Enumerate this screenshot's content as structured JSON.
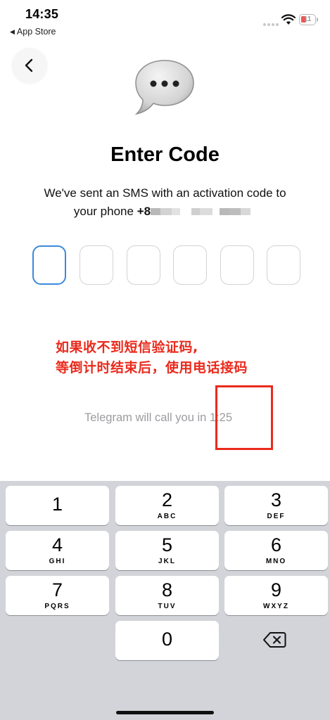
{
  "status_bar": {
    "time": "14:35",
    "back_app": "App Store",
    "battery_level": "11"
  },
  "header": {
    "title": "Enter Code",
    "subtitle_line1": "We've sent an SMS with an activation code to",
    "subtitle_line2_prefix": "your phone",
    "phone_visible": "+8"
  },
  "code_input": {
    "length": 6,
    "active_index": 0
  },
  "annotation": {
    "line1": "如果收不到短信验证码,",
    "line2": "等倒计时结束后，使用电话接码"
  },
  "call_timer": {
    "text": "Telegram will call you in",
    "countdown": "1:25"
  },
  "keypad": {
    "keys": [
      {
        "digit": "1",
        "letters": ""
      },
      {
        "digit": "2",
        "letters": "ABC"
      },
      {
        "digit": "3",
        "letters": "DEF"
      },
      {
        "digit": "4",
        "letters": "GHI"
      },
      {
        "digit": "5",
        "letters": "JKL"
      },
      {
        "digit": "6",
        "letters": "MNO"
      },
      {
        "digit": "7",
        "letters": "PQRS"
      },
      {
        "digit": "8",
        "letters": "TUV"
      },
      {
        "digit": "9",
        "letters": "WXYZ"
      },
      {
        "digit": "0",
        "letters": ""
      }
    ]
  },
  "colors": {
    "accent": "#3a8ad9",
    "annotation_red": "#ea2a1c",
    "keyboard_bg": "#d2d4d9",
    "muted_text": "#9c9ca1"
  }
}
